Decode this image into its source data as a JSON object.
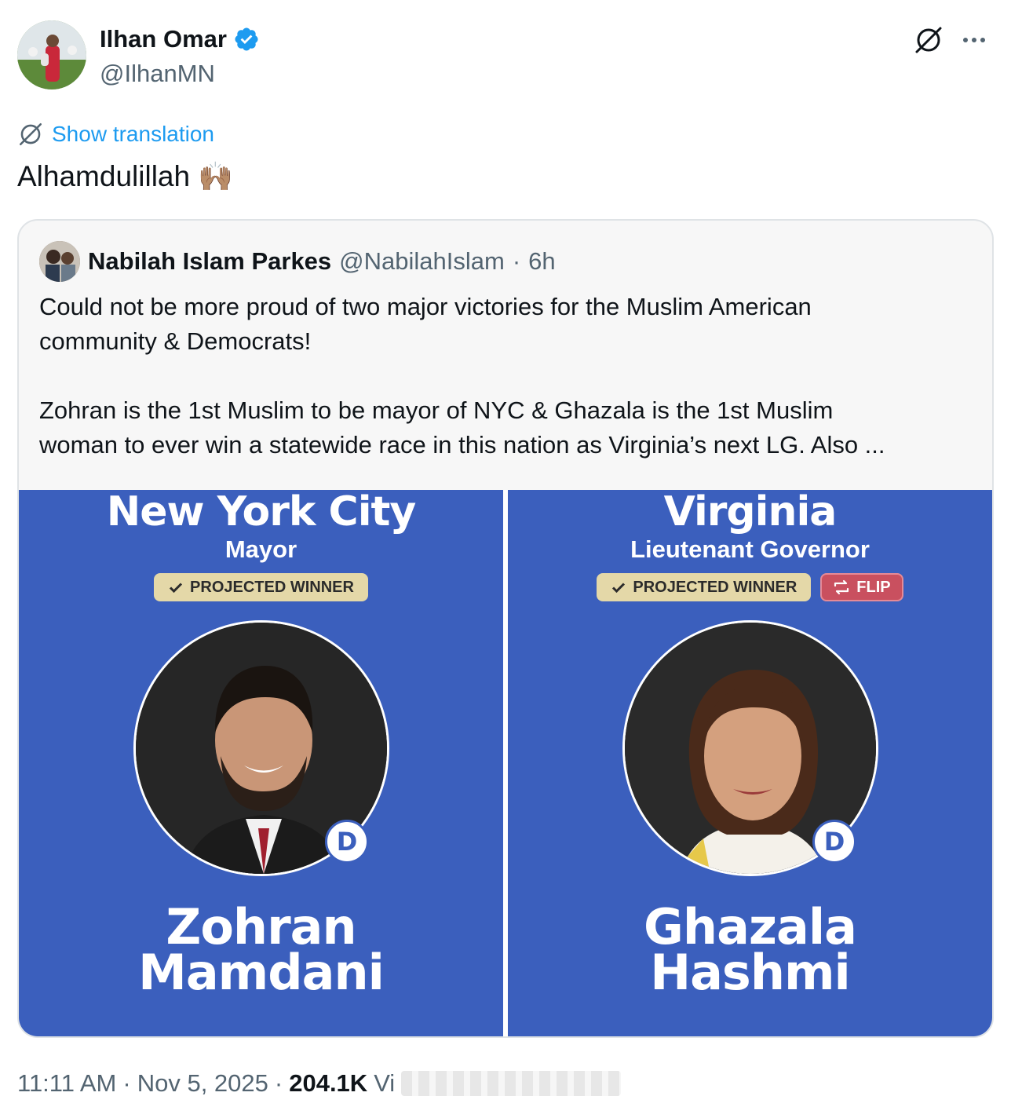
{
  "author": {
    "name": "Ilhan Omar",
    "handle": "@IlhanMN",
    "verified": true,
    "verified_color": "#1d9bf0"
  },
  "actions": {
    "grok_icon": "grok-icon",
    "more_icon": "more-icon"
  },
  "translate": {
    "label": "Show translation",
    "icon": "grok-icon"
  },
  "tweet": {
    "text": "Alhamdulillah",
    "emoji": "🙌🏽"
  },
  "quote": {
    "name": "Nabilah Islam Parkes",
    "handle": "@NabilahIslam",
    "separator": "·",
    "time": "6h",
    "lines1": [
      "Could not be more proud of two major victories for the Muslim American",
      "community & Democrats!"
    ],
    "lines2": [
      "Zohran is the 1st Muslim to be mayor of NYC  & Ghazala is the 1st Muslim",
      "woman to ever win a statewide race in this nation as Virginia’s next LG. Also ..."
    ]
  },
  "media": {
    "left": {
      "place": "New York City",
      "office": "Mayor",
      "badge": "PROJECTED WINNER",
      "party": "D",
      "first": "Zohran",
      "last": "Mamdani"
    },
    "right": {
      "place": "Virginia",
      "office": "Lieutenant Governor",
      "badge": "PROJECTED WINNER",
      "flip": "FLIP",
      "party": "D",
      "first": "Ghazala",
      "last": "Hashmi"
    },
    "panel_color": "#3b5fbd"
  },
  "meta": {
    "time": "11:11 AM",
    "date": "Nov 5, 2025",
    "separator": "·",
    "views": "204.1K",
    "views_label": "Vi"
  }
}
